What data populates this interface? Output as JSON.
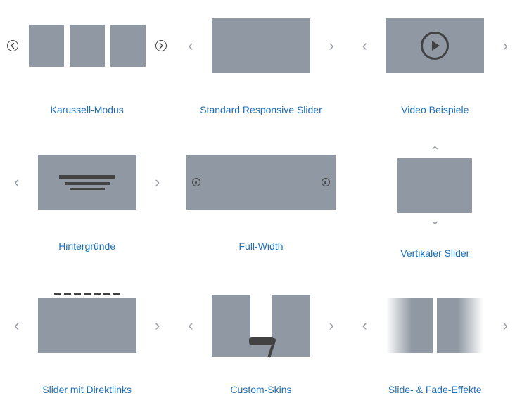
{
  "cards": [
    {
      "id": "karussell",
      "title": "Karussell-Modus",
      "nav_prev_icon": "chevron-left-circle-icon",
      "nav_next_icon": "chevron-right-circle-icon"
    },
    {
      "id": "standard",
      "title": "Standard Responsive Slider",
      "nav_prev_icon": "chevron-left-icon",
      "nav_next_icon": "chevron-right-icon"
    },
    {
      "id": "video",
      "title": "Video Beispiele",
      "nav_prev_icon": "chevron-left-icon",
      "nav_next_icon": "chevron-right-icon"
    },
    {
      "id": "hintergruende",
      "title": "Hintergründe",
      "nav_prev_icon": "chevron-left-icon",
      "nav_next_icon": "chevron-right-icon"
    },
    {
      "id": "fullwidth",
      "title": "Full-Width",
      "nav_prev_icon": "dot-left-icon",
      "nav_next_icon": "dot-right-icon"
    },
    {
      "id": "vertikal",
      "title": "Vertikaler Slider",
      "nav_prev_icon": "chevron-up-icon",
      "nav_next_icon": "chevron-down-icon"
    },
    {
      "id": "direktlinks",
      "title": "Slider mit Direktlinks",
      "nav_prev_icon": "chevron-left-icon",
      "nav_next_icon": "chevron-right-icon"
    },
    {
      "id": "customskins",
      "title": "Custom-Skins",
      "nav_prev_icon": "chevron-left-icon",
      "nav_next_icon": "chevron-right-icon"
    },
    {
      "id": "slidefade",
      "title": "Slide- & Fade-Effekte",
      "nav_prev_icon": "chevron-left-icon",
      "nav_next_icon": "chevron-right-icon"
    }
  ]
}
